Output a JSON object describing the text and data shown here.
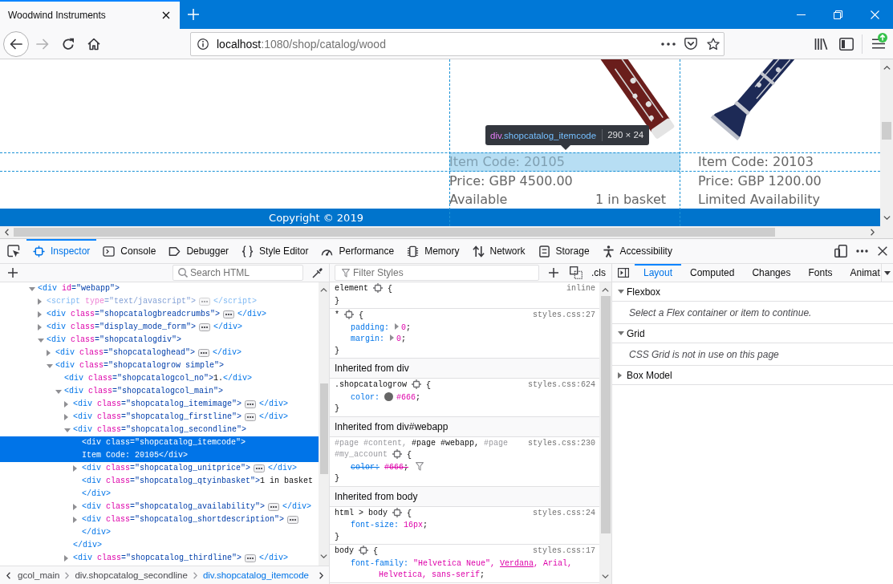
{
  "browser": {
    "tabs": [
      {
        "title": "Woodwind Instruments",
        "selected": true
      }
    ],
    "nav_buttons": [
      {
        "kind": "back",
        "disabled": false
      },
      {
        "kind": "forward",
        "disabled": true
      },
      {
        "kind": "reload",
        "disabled": false
      },
      {
        "kind": "home",
        "disabled": false
      }
    ],
    "url": {
      "host": "localhost",
      "rest": ":1080/shop/catalog/wood"
    },
    "menu": {
      "update_badge": true
    }
  },
  "page": {
    "products": [
      {
        "item_code": "Item Code: 20105",
        "highlighted": true,
        "price": "Price: GBP 4500.00",
        "availability": "Available",
        "basket": "1 in basket"
      },
      {
        "item_code": "Item Code: 20103",
        "highlighted": false,
        "price": "Price: GBP 1200.00",
        "availability": "Limited Availability"
      }
    ],
    "infobar": {
      "tag": "div",
      "classes": ".shopcatalog_itemcode",
      "size": "290 × 24"
    },
    "footer": "Copyright © 2019"
  },
  "devtools": {
    "tabs": [
      {
        "label": "Inspector",
        "selected": true
      },
      {
        "label": "Console",
        "selected": false
      },
      {
        "label": "Debugger",
        "selected": false
      },
      {
        "label": "Style Editor",
        "selected": false
      },
      {
        "label": "Performance",
        "selected": false
      },
      {
        "label": "Memory",
        "selected": false
      },
      {
        "label": "Network",
        "selected": false
      },
      {
        "label": "Storage",
        "selected": false
      },
      {
        "label": "Accessibility",
        "selected": false
      }
    ],
    "markup": {
      "search_placeholder": "Search HTML",
      "tree": [
        {
          "kind": "element",
          "open": "<div id=\"webapp\">",
          "expanded": true,
          "selected": false,
          "faded": false,
          "children": [
            {
              "kind": "element",
              "open": "<script type=\"text/javascript\">",
              "close": "</script>",
              "expanded": false,
              "selected": false,
              "faded": true
            },
            {
              "kind": "element",
              "open": "<div class=\"shopcatalogbreadcrumbs\">",
              "close": "</div>",
              "expanded": false,
              "selected": false,
              "faded": false
            },
            {
              "kind": "element",
              "open": "<div class=\"display_mode_form\">",
              "close": "</div>",
              "expanded": false,
              "selected": false,
              "faded": false
            },
            {
              "kind": "element",
              "open": "<div class=\"shopcatalogdiv\">",
              "expanded": true,
              "selected": false,
              "faded": false,
              "children": [
                {
                  "kind": "element",
                  "open": "<div class=\"shopcataloghead\">",
                  "close": "</div>",
                  "expanded": false,
                  "selected": false,
                  "faded": false
                },
                {
                  "kind": "element",
                  "open": "<div class=\"shopcatalogrow simple\">",
                  "expanded": true,
                  "selected": false,
                  "faded": false,
                  "children": [
                    {
                      "kind": "text_element",
                      "open": "<div class=\"shopcatalogcol_no\">",
                      "text": "1.",
                      "close": "</div>",
                      "selected": false,
                      "faded": false
                    },
                    {
                      "kind": "element",
                      "open": "<div class=\"shopcatalogcol_main\">",
                      "expanded": true,
                      "selected": false,
                      "faded": false,
                      "children": [
                        {
                          "kind": "element",
                          "open": "<div class=\"shopcatalog_itemimage\">",
                          "close": "</div>",
                          "expanded": false,
                          "selected": false,
                          "faded": false
                        },
                        {
                          "kind": "element",
                          "open": "<div class=\"shopcatalog_firstline\">",
                          "close": "</div>",
                          "expanded": false,
                          "selected": false,
                          "faded": false
                        },
                        {
                          "kind": "element",
                          "open": "<div class=\"shopcatalog_secondline\">",
                          "close": "</div>",
                          "expanded": true,
                          "selected": false,
                          "faded": false,
                          "children": [
                            {
                              "kind": "text_element",
                              "open": "<div class=\"shopcatalog_itemcode\">",
                              "text": "Item Code: 20105",
                              "close": "</div>",
                              "selected": true,
                              "faded": false
                            },
                            {
                              "kind": "element",
                              "open": "<div class=\"shopcatalog_unitprice\">",
                              "close": "</div>",
                              "expanded": false,
                              "selected": false,
                              "faded": false
                            },
                            {
                              "kind": "text_element",
                              "open": "<div class=\"shopcatalog_qtyinbasket\">",
                              "text": "1 in basket",
                              "close": "</div>",
                              "selected": false,
                              "faded": false
                            },
                            {
                              "kind": "element",
                              "open": "<div class=\"shopcatalog_availability\">",
                              "close": "</div>",
                              "expanded": false,
                              "selected": false,
                              "faded": false
                            },
                            {
                              "kind": "element",
                              "open": "<div class=\"shopcatalog_shortdescription\">",
                              "close": "</div>",
                              "expanded": false,
                              "selected": false,
                              "faded": false
                            }
                          ]
                        },
                        {
                          "kind": "element",
                          "open": "<div class=\"shopcatalog_thirdline\">",
                          "close": "</div>",
                          "expanded": false,
                          "selected": false,
                          "faded": false
                        }
                      ]
                    }
                  ]
                }
              ]
            }
          ]
        }
      ],
      "breadcrumbs": [
        {
          "label": "gcol_main",
          "selected": false
        },
        {
          "label": "div.shopcatalog_secondline",
          "selected": false
        },
        {
          "label": "div.shopcatalog_itemcode",
          "selected": true
        }
      ]
    },
    "rules": {
      "filter_placeholder": "Filter Styles",
      "class_toggle": ".cls",
      "blocks": [
        {
          "kind": "rule",
          "selector": [
            {
              "text": "element",
              "matched": true
            }
          ],
          "open": "{",
          "source": "inline",
          "close": "}"
        },
        {
          "kind": "rule",
          "selector": [
            {
              "text": "*",
              "matched": true
            }
          ],
          "open": "{",
          "source": "styles.css:27",
          "declarations": [
            {
              "name": "padding:",
              "expandable": true,
              "overridden": false,
              "value": [
                {
                  "text": "0;",
                  "underlined": false
                }
              ]
            },
            {
              "name": "margin:",
              "expandable": true,
              "overridden": false,
              "value": [
                {
                  "text": "0;",
                  "underlined": false
                }
              ]
            }
          ],
          "close": "}"
        },
        {
          "kind": "header",
          "text": "Inherited from div"
        },
        {
          "kind": "rule",
          "selector": [
            {
              "text": ".shopcatalogrow",
              "matched": true
            }
          ],
          "open": "{",
          "source": "styles.css:624",
          "declarations": [
            {
              "name": "color:",
              "expandable": false,
              "overridden": false,
              "color": "#666666",
              "value": [
                {
                  "text": "#666;",
                  "underlined": false
                }
              ]
            }
          ],
          "close": "}"
        },
        {
          "kind": "header",
          "text": "Inherited from div#webapp"
        },
        {
          "kind": "rule",
          "selector": [
            {
              "text": "#page #content,",
              "matched": false
            },
            {
              "text": "#page #webapp,",
              "matched": true
            },
            {
              "text": "#page",
              "matched": false
            },
            {
              "text": "#my_account",
              "matched": false
            }
          ],
          "open": "{",
          "source": "styles.css:230",
          "declarations": [
            {
              "name": "color:",
              "expandable": false,
              "overridden": true,
              "value": [
                {
                  "text": "#666;",
                  "underlined": false
                }
              ]
            }
          ],
          "close": "}"
        },
        {
          "kind": "header",
          "text": "Inherited from body"
        },
        {
          "kind": "rule",
          "selector": [
            {
              "text": "html > body",
              "matched": true
            }
          ],
          "open": "{",
          "source": "styles.css:24",
          "declarations": [
            {
              "name": "font-size:",
              "expandable": false,
              "overridden": false,
              "value": [
                {
                  "text": "16px;",
                  "underlined": false
                }
              ]
            }
          ],
          "close": "}"
        },
        {
          "kind": "rule",
          "selector": [
            {
              "text": "body",
              "matched": true
            }
          ],
          "open": "{",
          "source": "styles.css:17",
          "declarations": [
            {
              "name": "font-family:",
              "expandable": false,
              "overridden": false,
              "value": [
                {
                  "text": "\"Helvetica Neue\", ",
                  "underlined": false
                },
                {
                  "text": "Verdana",
                  "underlined": true
                },
                {
                  "text": ", Arial, ",
                  "underlined": false
                },
                {
                  "text": "Helvetica, sans-serif;",
                  "underlined": false
                }
              ]
            }
          ]
        }
      ]
    },
    "sidebar": {
      "tabs": [
        {
          "label": "Layout",
          "selected": true
        },
        {
          "label": "Computed",
          "selected": false
        },
        {
          "label": "Changes",
          "selected": false
        },
        {
          "label": "Fonts",
          "selected": false
        },
        {
          "label": "Animat",
          "selected": false
        }
      ],
      "sections": [
        {
          "title": "Flexbox",
          "expanded": true,
          "message": "Select a Flex container or item to continue."
        },
        {
          "title": "Grid",
          "expanded": true,
          "message": "CSS Grid is not in use on this page"
        },
        {
          "title": "Box Model",
          "expanded": false
        }
      ]
    }
  }
}
